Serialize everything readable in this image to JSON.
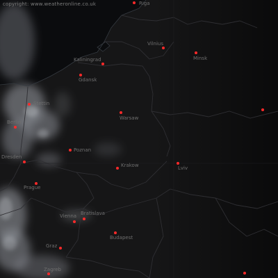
{
  "copyright": "copyright: www.weatheronline.co.uk",
  "colors": {
    "background": "#0e0e0f",
    "cloud": "#9a9ea6",
    "border": "#2f2f33",
    "coast": "#353a40",
    "city_dot": "#ff2a2a",
    "label": "#6f6f6f"
  },
  "cities": [
    {
      "id": "riga",
      "name": "Riga"
    },
    {
      "id": "vilnius",
      "name": "Vilnius"
    },
    {
      "id": "minsk",
      "name": "Minsk"
    },
    {
      "id": "kaliningrad",
      "name": "Kaliningrad"
    },
    {
      "id": "gdansk",
      "name": "Gdansk"
    },
    {
      "id": "szczecin",
      "name": "Stettin"
    },
    {
      "id": "berlin",
      "name": "Berlin"
    },
    {
      "id": "warsaw",
      "name": "Warsaw"
    },
    {
      "id": "poznan",
      "name": "Poznan"
    },
    {
      "id": "dresden",
      "name": "Dresden"
    },
    {
      "id": "krakow",
      "name": "Krakow"
    },
    {
      "id": "lviv",
      "name": "Lviv"
    },
    {
      "id": "prague",
      "name": "Prague"
    },
    {
      "id": "vienna",
      "name": "Vienna"
    },
    {
      "id": "bratislava",
      "name": "Bratislava"
    },
    {
      "id": "budapest",
      "name": "Budapest"
    },
    {
      "id": "graz",
      "name": "Graz"
    },
    {
      "id": "zagreb",
      "name": "Zagreb"
    },
    {
      "id": "kyiv",
      "name": ""
    },
    {
      "id": "iasi",
      "name": ""
    }
  ]
}
